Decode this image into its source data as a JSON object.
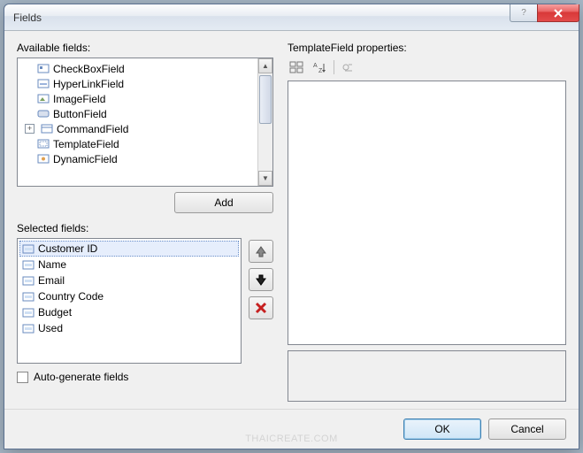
{
  "window": {
    "title": "Fields"
  },
  "labels": {
    "available": "Available fields:",
    "selected": "Selected fields:",
    "properties": "TemplateField properties:",
    "add": "Add",
    "autogen": "Auto-generate fields",
    "ok": "OK",
    "cancel": "Cancel"
  },
  "available_fields": [
    "CheckBoxField",
    "HyperLinkField",
    "ImageField",
    "ButtonField",
    "CommandField",
    "TemplateField",
    "DynamicField"
  ],
  "selected_fields": [
    "Customer ID",
    "Name",
    "Email",
    "Country Code",
    "Budget",
    "Used"
  ],
  "watermark": "THAICREATE.COM"
}
